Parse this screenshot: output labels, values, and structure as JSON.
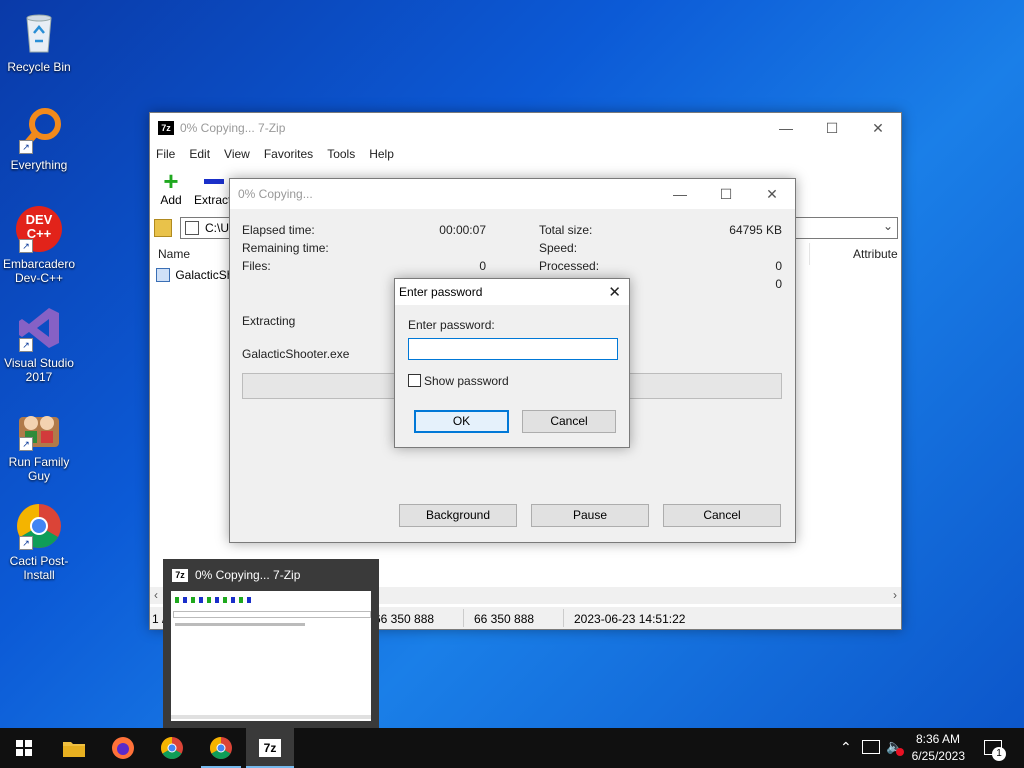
{
  "desktop": {
    "icons": [
      {
        "label": "Recycle Bin",
        "icon": "recycle-bin-icon"
      },
      {
        "label": "Everything",
        "icon": "everything-search-icon"
      },
      {
        "label": "Embarcadero Dev-C++",
        "icon": "devcpp-icon",
        "badge": "DEV C++"
      },
      {
        "label": "Visual Studio 2017",
        "icon": "visual-studio-icon"
      },
      {
        "label": "Run Family Guy",
        "icon": "family-guy-icon"
      },
      {
        "label": "Cacti Post-Install",
        "icon": "chrome-icon"
      }
    ]
  },
  "main_window": {
    "logo": "7z",
    "title": "0% Copying... 7-Zip",
    "menu": [
      "File",
      "Edit",
      "View",
      "Favorites",
      "Tools",
      "Help"
    ],
    "toolbar": {
      "add": "Add",
      "extract": "Extract"
    },
    "address": "C:\\U",
    "columns": {
      "name": "Name",
      "attributes": "Attribute"
    },
    "file_name": "GalacticSho",
    "status": {
      "left": "1 /",
      "size1": "66 350 888",
      "size2": "66 350 888",
      "date": "2023-06-23 14:51:22"
    }
  },
  "progress_dialog": {
    "title": "0% Copying...",
    "elapsed_label": "Elapsed time:",
    "elapsed_value": "00:00:07",
    "remaining_label": "Remaining time:",
    "files_label": "Files:",
    "files_value": "0",
    "total_label": "Total size:",
    "total_value": "64795 KB",
    "speed_label": "Speed:",
    "processed_label": "Processed:",
    "processed_value": "0",
    "extra_value": "0",
    "action": "Extracting",
    "current_file": "GalacticShooter.exe",
    "background_button": "Background",
    "pause_button": "Pause",
    "cancel_button": "Cancel"
  },
  "password_dialog": {
    "title": "Enter password",
    "prompt": "Enter password:",
    "password_value": "",
    "show_password_label": "Show password",
    "ok_button": "OK",
    "cancel_button": "Cancel"
  },
  "thumbnail": {
    "logo": "7z",
    "title": "0% Copying... 7-Zip"
  },
  "taskbar": {
    "time": "8:36 AM",
    "date": "6/25/2023",
    "notification_count": "1",
    "app_icon_label": "7z"
  }
}
